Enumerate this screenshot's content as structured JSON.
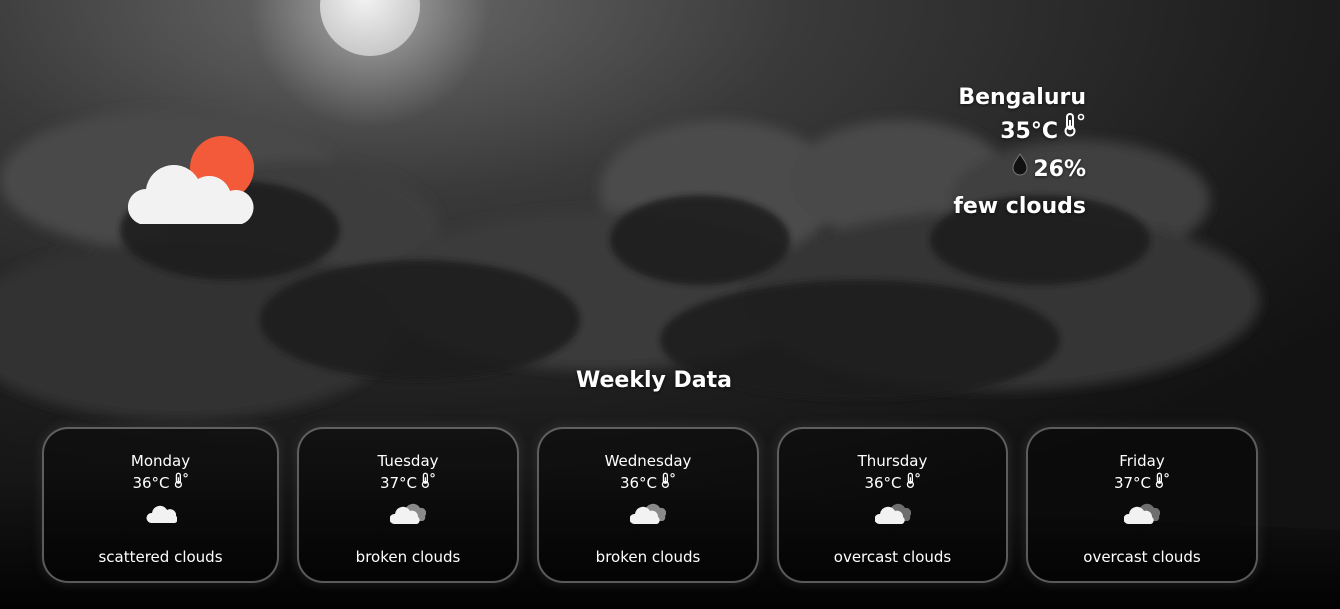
{
  "current": {
    "city": "Bengaluru",
    "temperature": "35°C",
    "humidity": "26%",
    "description": "few clouds",
    "icon": "partly-cloudy-sun-icon",
    "colors": {
      "sun": "#f25a3a",
      "cloud": "#f2f2f2"
    }
  },
  "weekly": {
    "title": "Weekly Data",
    "days": [
      {
        "day": "Monday",
        "temp": "36°C",
        "icon": "cloud-icon",
        "desc": "scattered clouds"
      },
      {
        "day": "Tuesday",
        "temp": "37°C",
        "icon": "broken-clouds-icon",
        "desc": "broken clouds"
      },
      {
        "day": "Wednesday",
        "temp": "36°C",
        "icon": "broken-clouds-icon",
        "desc": "broken clouds"
      },
      {
        "day": "Thursday",
        "temp": "36°C",
        "icon": "overcast-clouds-icon",
        "desc": "overcast clouds"
      },
      {
        "day": "Friday",
        "temp": "37°C",
        "icon": "overcast-clouds-icon",
        "desc": "overcast clouds"
      }
    ]
  }
}
